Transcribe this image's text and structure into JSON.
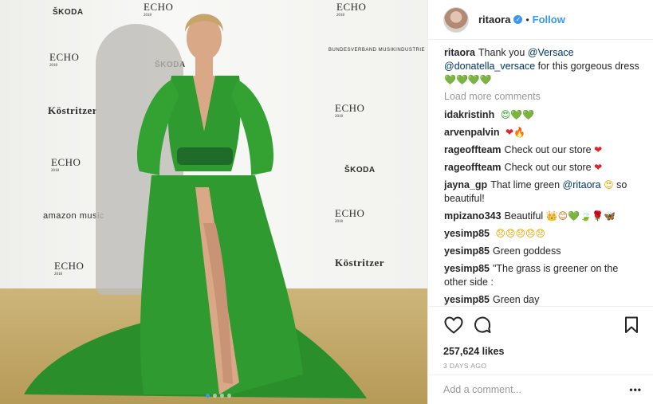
{
  "post": {
    "username": "ritaora",
    "separator": "•",
    "follow_label": "Follow",
    "caption": {
      "user": "ritaora",
      "text_before": "Thank you ",
      "mention1": "@Versace",
      "mention2": "@donatella_versace",
      "text_after": " for this gorgeous dress",
      "emoji": "💚💚💚💚"
    },
    "load_more": "Load more comments",
    "comments": [
      {
        "user": "idakristinh",
        "text": "",
        "emoji": "😍💚💚"
      },
      {
        "user": "arvenpalvin",
        "text": "",
        "emoji": "❤🔥"
      },
      {
        "user": "rageoffteam",
        "text": "Check out our store",
        "emoji": "❤"
      },
      {
        "user": "rageoffteam",
        "text": "Check out our store",
        "emoji": "❤"
      },
      {
        "user": "jayna_gp",
        "text": "That lime green ",
        "mention": "@ritaora",
        "emoji": "😍",
        "text_after": " so beautiful!"
      },
      {
        "user": "mpizano343",
        "text": "Beautiful ",
        "emoji": "👑😊💚🍃🌹🦋"
      },
      {
        "user": "yesimp85",
        "text": "",
        "emoji": "😞😞😞😞😞"
      },
      {
        "user": "yesimp85",
        "text": "Green goddess",
        "emoji": ""
      },
      {
        "user": "yesimp85",
        "text": "\"The grass is greener on the other side :",
        "emoji": ""
      },
      {
        "user": "yesimp85",
        "text": "Green day",
        "emoji": ""
      }
    ],
    "likes": "257,624 likes",
    "age": "3 DAYS AGO",
    "add_comment_placeholder": "Add a comment...",
    "more_label": "•••"
  },
  "photo": {
    "alt": "Woman in long green gown on press wall",
    "logos": [
      "ŠKODA",
      "ECHO",
      "Köstritzer",
      "amazon music",
      "BUNDESVERBAND MUSIKINDUSTRIE"
    ],
    "dots_total": 4,
    "dots_active": 1
  },
  "icons": {
    "like": "heart-icon",
    "comment": "comment-bubble-icon",
    "save": "bookmark-icon",
    "verified": "verified-badge-icon"
  },
  "colors": {
    "link": "#3897f0",
    "mention": "#003569",
    "muted": "#999999",
    "dress_green": "#2f9a2f",
    "floor": "#c3a964"
  }
}
